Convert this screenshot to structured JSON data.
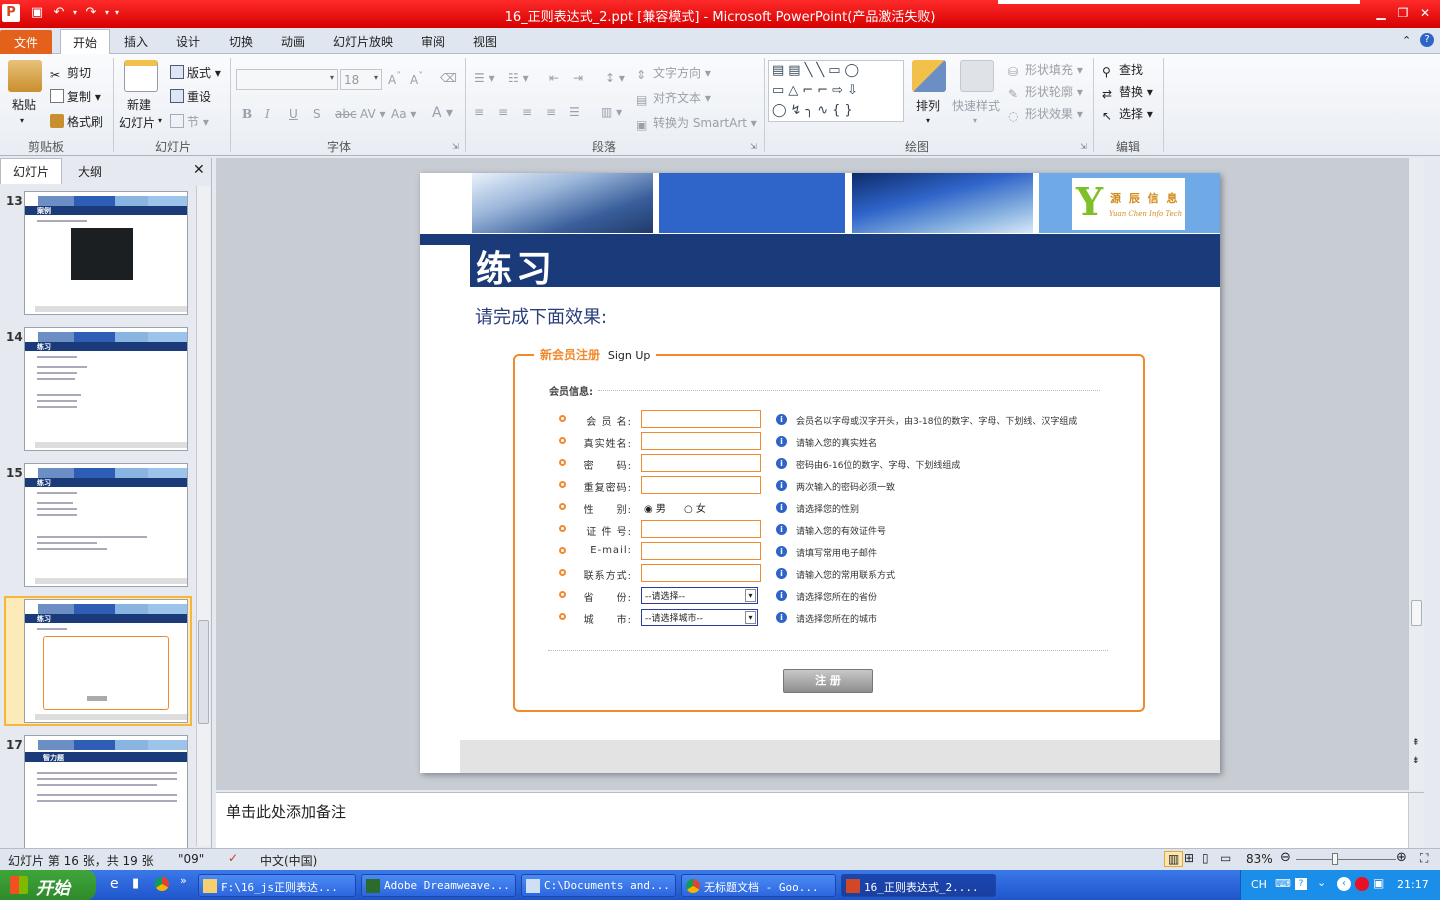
{
  "window": {
    "title": "16_正则表达式_2.ppt [兼容模式]  -  Microsoft PowerPoint(产品激活失败)"
  },
  "tabs": [
    "文件",
    "开始",
    "插入",
    "设计",
    "切换",
    "动画",
    "幻灯片放映",
    "审阅",
    "视图"
  ],
  "ribbon": {
    "clipboard": {
      "paste": "粘贴",
      "cut": "剪切",
      "copy": "复制",
      "format_painter": "格式刷",
      "group": "剪贴板"
    },
    "slides": {
      "new_slide_1": "新建",
      "new_slide_2": "幻灯片",
      "layout": "版式",
      "reset": "重设",
      "section": "节",
      "group": "幻灯片"
    },
    "font": {
      "font_size": "18",
      "group": "字体"
    },
    "paragraph": {
      "text_direction": "文字方向",
      "align_text": "对齐文本",
      "convert_smartart": "转换为 SmartArt",
      "group": "段落"
    },
    "drawing": {
      "arrange": "排列",
      "quick_styles": "快速样式",
      "shape_fill": "形状填充",
      "shape_outline": "形状轮廓",
      "shape_effects": "形状效果",
      "group": "绘图"
    },
    "editing": {
      "find": "查找",
      "replace": "替换",
      "select": "选择",
      "group": "编辑"
    }
  },
  "panel": {
    "tab_slides": "幻灯片",
    "tab_outline": "大纲"
  },
  "thumbnails": [
    {
      "num": "13",
      "label": "案例"
    },
    {
      "num": "14",
      "label": "练习"
    },
    {
      "num": "15",
      "label": "练习"
    },
    {
      "num": "16",
      "label": "练习"
    },
    {
      "num": "17",
      "label": "智力题"
    }
  ],
  "slide": {
    "logo_text_1": "源 辰 信 息",
    "logo_text_2": "Yuan Chen Info Tech",
    "title": "练习",
    "subtitle": "请完成下面效果:",
    "form_title": "新会员注册",
    "form_title_en": "Sign Up",
    "section_label": "会员信息:",
    "fields": [
      {
        "label": "会 员 名:",
        "hint": "会员名以字母或汉字开头，由3-18位的数字、字母、下划线、汉字组成"
      },
      {
        "label": "真实姓名:",
        "hint": "请输入您的真实姓名"
      },
      {
        "label": "密　　码:",
        "hint": "密码由6-16位的数字、字母、下划线组成"
      },
      {
        "label": "重复密码:",
        "hint": "两次输入的密码必须一致"
      },
      {
        "label": "性　　别:",
        "hint": "请选择您的性别"
      },
      {
        "label": "证 件 号:",
        "hint": "请输入您的有效证件号"
      },
      {
        "label": "E-mail:",
        "hint": "请填写常用电子邮件"
      },
      {
        "label": "联系方式:",
        "hint": "请输入您的常用联系方式"
      },
      {
        "label": "省　　份:",
        "hint": "请选择您所在的省份"
      },
      {
        "label": "城　　市:",
        "hint": "请选择您所在的城市"
      }
    ],
    "gender_male": "男",
    "gender_female": "女",
    "province_select": "--请选择--",
    "city_select": "--请选择城市--",
    "submit": "注 册"
  },
  "notes_placeholder": "单击此处添加备注",
  "status": {
    "slide_info": "幻灯片 第 16 张，共 19 张",
    "theme": "\"09\"",
    "language": "中文(中国)",
    "zoom": "83%"
  },
  "taskbar": {
    "start": "开始",
    "items": [
      "F:\\16_js正则表达...",
      "Adobe Dreamweave...",
      "C:\\Documents and...",
      "无标题文档 - Goo...",
      "16_正则表达式_2...."
    ],
    "tray_lang": "CH",
    "clock": "21:17"
  }
}
